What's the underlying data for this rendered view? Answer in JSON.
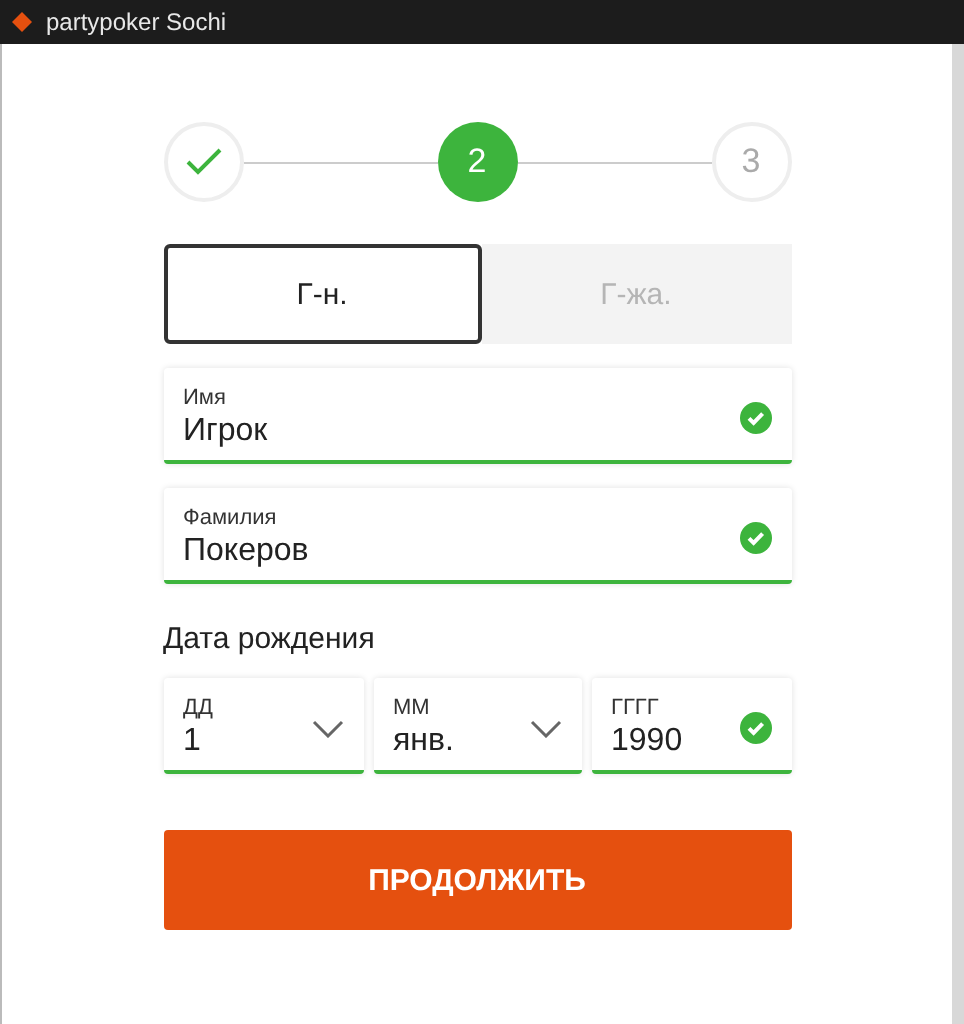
{
  "window": {
    "title": "partypoker Sochi"
  },
  "steps": [
    {
      "kind": "done"
    },
    {
      "kind": "current",
      "label": "2"
    },
    {
      "kind": "upcoming",
      "label": "3"
    }
  ],
  "gender_tabs": [
    {
      "label": "Г-н.",
      "selected": true
    },
    {
      "label": "Г-жа.",
      "selected": false
    }
  ],
  "name_fields": [
    {
      "label": "Имя",
      "value": "Игрок",
      "valid": true
    },
    {
      "label": "Фамилия",
      "value": "Покеров",
      "valid": true
    }
  ],
  "birth_date": {
    "title": "Дата рождения",
    "fields": [
      {
        "kind": "select",
        "label": "ДД",
        "value": "1",
        "valid": false
      },
      {
        "kind": "select",
        "label": "ММ",
        "value": "янв.",
        "valid": false
      },
      {
        "kind": "input",
        "label": "ГГГГ",
        "value": "1990",
        "valid": true
      }
    ]
  },
  "continue_button": "ПРОДОЛЖИТЬ"
}
